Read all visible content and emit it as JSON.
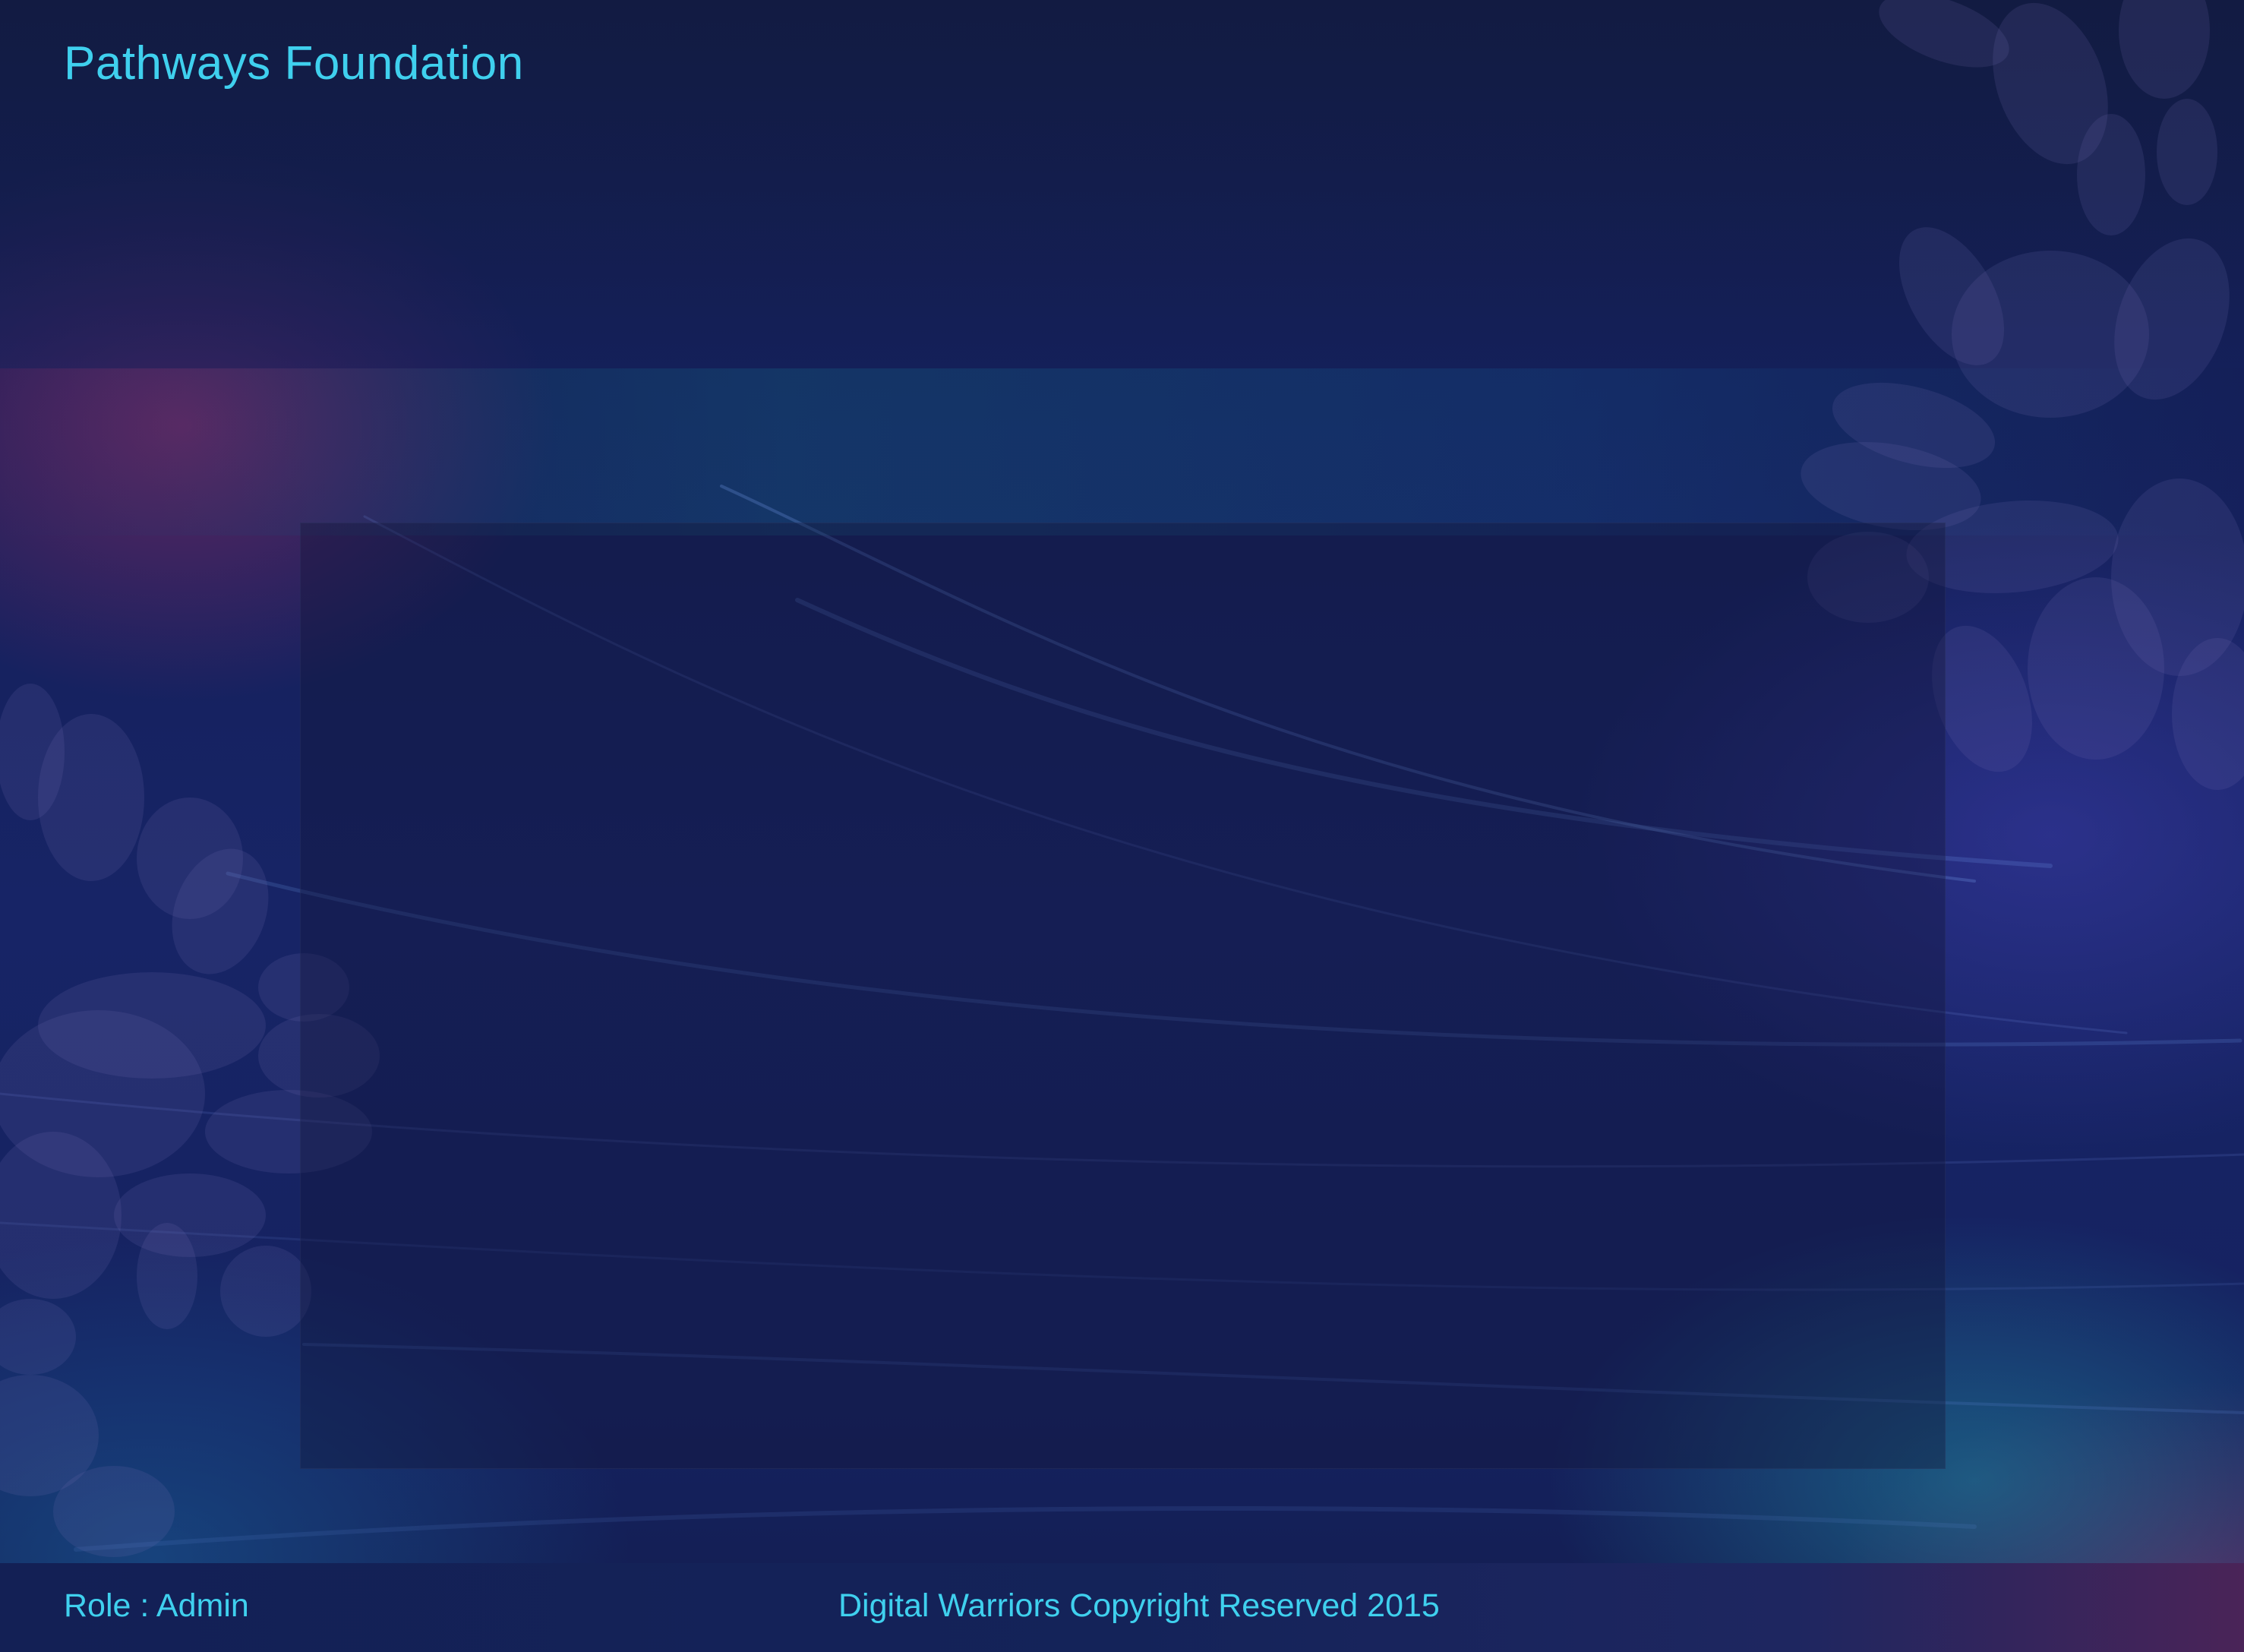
{
  "header": {
    "brand_title": "Pathways Foundation"
  },
  "main": {
    "content_panel_empty": true
  },
  "footer": {
    "role_label": "Role : Admin",
    "copyright": "Digital Warriors Copyright Reserved 2015"
  },
  "colors": {
    "accent_text": "#3fd0ee",
    "background_dark": "#131c45",
    "background_blue": "#172466",
    "magenta_glow": "#7a2864",
    "teal_glow": "#1e7896"
  }
}
